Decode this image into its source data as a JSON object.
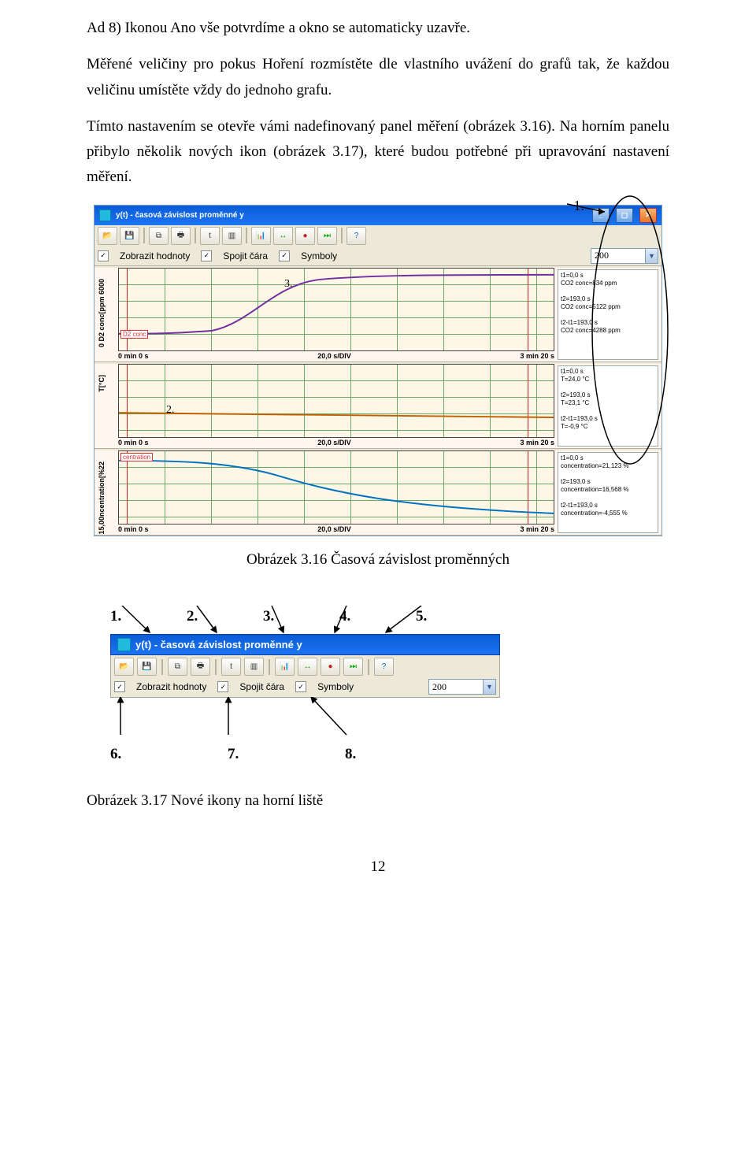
{
  "paragraphs": {
    "p1": "Ad 8) Ikonou Ano vše potvrdíme a okno se automaticky uzavře.",
    "p2": "Měřené veličiny pro pokus Hoření rozmístěte dle vlastního uvážení do grafů tak, že každou veličinu umístěte vždy do jednoho grafu.",
    "p3": "Tímto nastavením se otevře vámi nadefinovaný panel měření (obrázek 3.16). Na horním panelu přibylo několik nových ikon (obrázek 3.17), které budou potřebné při upravování nastavení měření."
  },
  "captions": {
    "c1": "Obrázek 3.16 Časová závislost proměnných",
    "c2": "Obrázek 3.17 Nové ikony na horní liště"
  },
  "numbers_top": [
    "1.",
    "2.",
    "3.",
    "4.",
    "5."
  ],
  "numbers_bottom": [
    "6.",
    "7.",
    "8."
  ],
  "page_no": "12",
  "window": {
    "title": "y(t) - časová závislost proměnné y",
    "toolbar_t": "t",
    "check1": "Zobrazit hodnoty",
    "check2": "Spojit čára",
    "check3": "Symboly",
    "combo": "200",
    "axis_left": "0 min 0 s",
    "axis_mid": "20,0 s/DIV",
    "axis_right": "3 min 20 s",
    "plots": [
      {
        "ylabel": "0 D2 conc[ppm 6000",
        "badge": "D2 conc",
        "curve": "co2",
        "ann": "3.",
        "info": "t1=0,0 s\nCO2 conc=834 ppm\n\nt2=193,0 s\nCO2 conc=5122 ppm\n\nt2-t1=193,0 s\nCO2 conc=4288 ppm"
      },
      {
        "ylabel": "T[°C]",
        "yscale": "10         50",
        "badge": "",
        "curve": "temp",
        "ann": "2.",
        "info": "t1=0,0 s\nT=24,0 °C\n\nt2=193,0 s\nT=23,1 °C\n\nt2-t1=193,0 s\nT=-0,9 °C"
      },
      {
        "ylabel": "15,00ncentration[%22",
        "badge": "centration",
        "curve": "o2",
        "ann": "",
        "info": "t1=0,0 s\nconcentration=21,123 %\n\nt2=193,0 s\nconcentration=16,568 %\n\nt2-t1=193,0 s\nconcentration=-4,555 %"
      }
    ]
  }
}
